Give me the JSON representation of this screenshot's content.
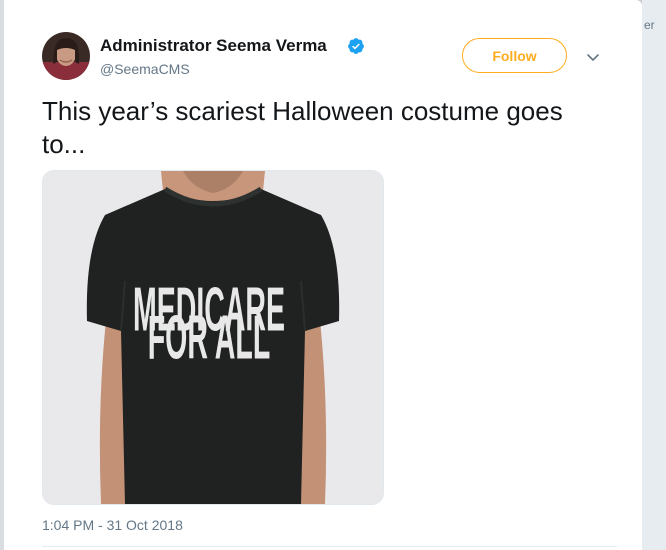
{
  "background": {
    "fragment_text": "er"
  },
  "tweet": {
    "author_name": "Administrator Seema Verma",
    "handle": "@SeemaCMS",
    "verified": true,
    "follow_label": "Follow",
    "text": "This year’s scariest Halloween costume goes to...",
    "timestamp": "1:04 PM - 31 Oct 2018",
    "media": {
      "shirt_print_line1": "MEDICARE",
      "shirt_print_line2": "FOR ALL",
      "shirt_color": "#1f2221"
    }
  },
  "colors": {
    "follow_accent": "#ffad1f",
    "verified_blue": "#1da1f2",
    "text_primary": "#14171a",
    "text_secondary": "#657786"
  },
  "icons": {
    "verified": "verified-badge-icon",
    "more": "chevron-down-icon"
  }
}
